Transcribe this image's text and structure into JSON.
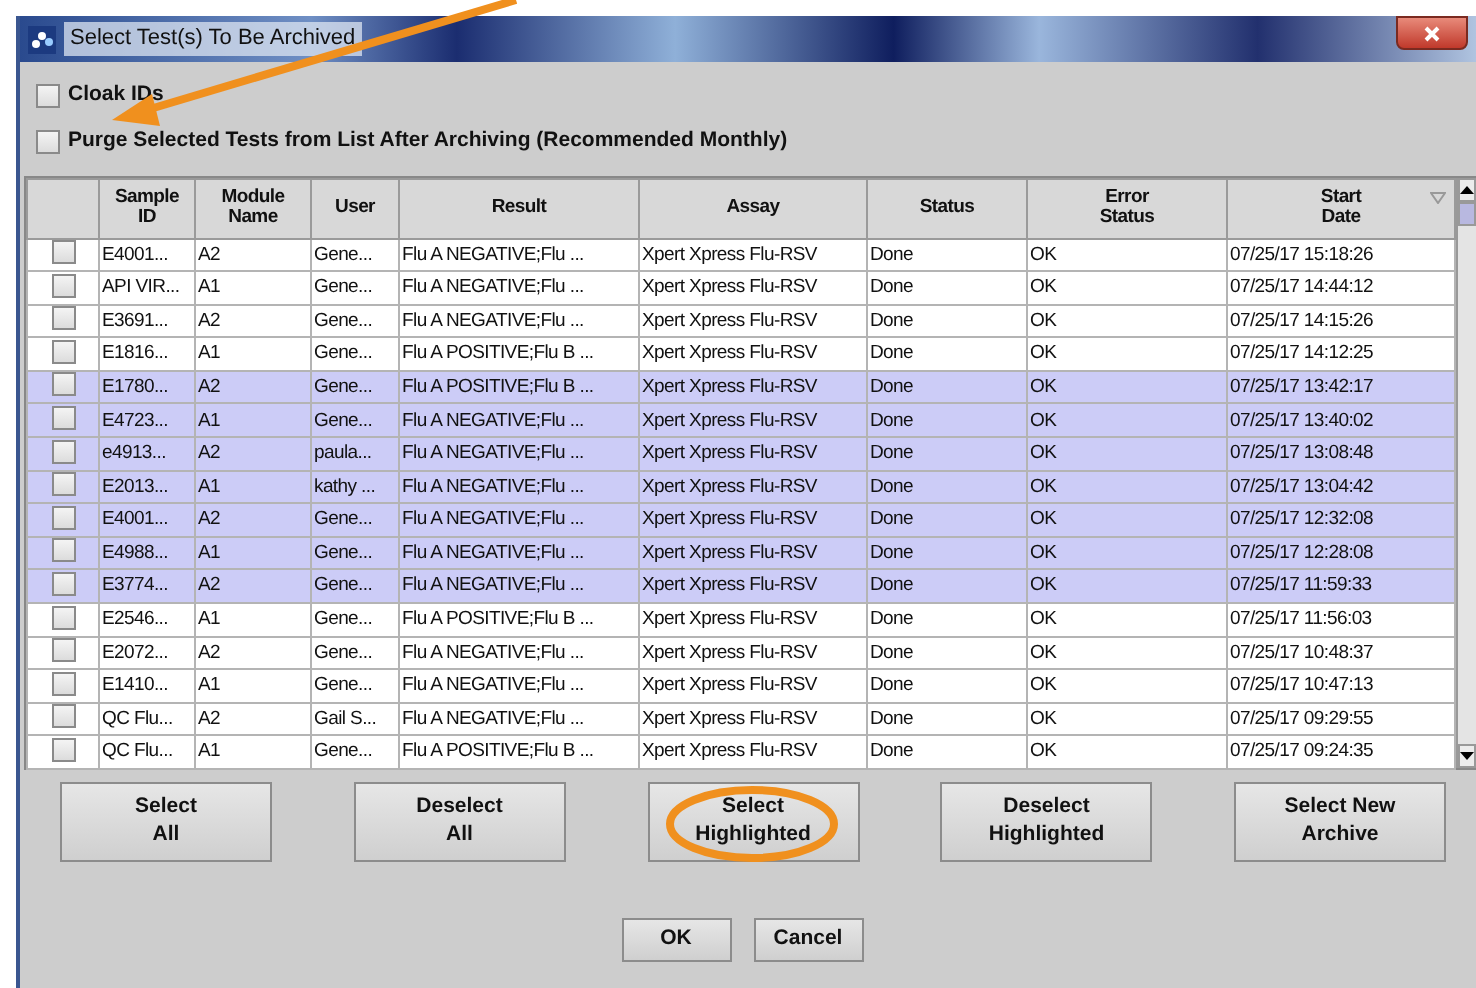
{
  "window": {
    "title": "Select Test(s) To Be Archived"
  },
  "options": [
    {
      "label": "Cloak IDs",
      "checked": false
    },
    {
      "label": "Purge Selected Tests from List After Archiving (Recommended Monthly)",
      "checked": false
    }
  ],
  "table": {
    "columns": [
      {
        "label": "Sample ID",
        "sorted": false
      },
      {
        "label": "Module Name",
        "sorted": false
      },
      {
        "label": "User",
        "sorted": false
      },
      {
        "label": "Result",
        "sorted": false
      },
      {
        "label": "Assay",
        "sorted": false
      },
      {
        "label": "Status",
        "sorted": false
      },
      {
        "label": "Error Status",
        "sorted": false
      },
      {
        "label": "Start Date",
        "sorted": true
      }
    ],
    "rows": [
      {
        "checked": false,
        "selected": false,
        "cells": [
          "E4001...",
          "A2",
          "Gene...",
          "Flu A NEGATIVE;Flu ...",
          "Xpert Xpress Flu-RSV",
          "Done",
          "OK",
          "07/25/17 15:18:26"
        ]
      },
      {
        "checked": false,
        "selected": false,
        "cells": [
          "API VIR...",
          "A1",
          "Gene...",
          "Flu A NEGATIVE;Flu ...",
          "Xpert Xpress Flu-RSV",
          "Done",
          "OK",
          "07/25/17 14:44:12"
        ]
      },
      {
        "checked": false,
        "selected": false,
        "cells": [
          "E3691...",
          "A2",
          "Gene...",
          "Flu A NEGATIVE;Flu ...",
          "Xpert Xpress Flu-RSV",
          "Done",
          "OK",
          "07/25/17 14:15:26"
        ]
      },
      {
        "checked": false,
        "selected": false,
        "cells": [
          "E1816...",
          "A1",
          "Gene...",
          "Flu A POSITIVE;Flu B ...",
          "Xpert Xpress Flu-RSV",
          "Done",
          "OK",
          "07/25/17 14:12:25"
        ]
      },
      {
        "checked": false,
        "selected": true,
        "cells": [
          "E1780...",
          "A2",
          "Gene...",
          "Flu A POSITIVE;Flu B ...",
          "Xpert Xpress Flu-RSV",
          "Done",
          "OK",
          "07/25/17 13:42:17"
        ]
      },
      {
        "checked": false,
        "selected": true,
        "cells": [
          "E4723...",
          "A1",
          "Gene...",
          "Flu A NEGATIVE;Flu ...",
          "Xpert Xpress Flu-RSV",
          "Done",
          "OK",
          "07/25/17 13:40:02"
        ]
      },
      {
        "checked": false,
        "selected": true,
        "cells": [
          "e4913...",
          "A2",
          "paula...",
          "Flu A NEGATIVE;Flu ...",
          "Xpert Xpress Flu-RSV",
          "Done",
          "OK",
          "07/25/17 13:08:48"
        ]
      },
      {
        "checked": false,
        "selected": true,
        "cells": [
          "E2013...",
          "A1",
          "kathy ...",
          "Flu A NEGATIVE;Flu ...",
          "Xpert Xpress Flu-RSV",
          "Done",
          "OK",
          "07/25/17 13:04:42"
        ]
      },
      {
        "checked": false,
        "selected": true,
        "cells": [
          "E4001...",
          "A2",
          "Gene...",
          "Flu A NEGATIVE;Flu ...",
          "Xpert Xpress Flu-RSV",
          "Done",
          "OK",
          "07/25/17 12:32:08"
        ]
      },
      {
        "checked": false,
        "selected": true,
        "cells": [
          "E4988...",
          "A1",
          "Gene...",
          "Flu A NEGATIVE;Flu ...",
          "Xpert Xpress Flu-RSV",
          "Done",
          "OK",
          "07/25/17 12:28:08"
        ]
      },
      {
        "checked": false,
        "selected": true,
        "cells": [
          "E3774...",
          "A2",
          "Gene...",
          "Flu A NEGATIVE;Flu ...",
          "Xpert Xpress Flu-RSV",
          "Done",
          "OK",
          "07/25/17 11:59:33"
        ]
      },
      {
        "checked": false,
        "selected": false,
        "cells": [
          "E2546...",
          "A1",
          "Gene...",
          "Flu A POSITIVE;Flu B ...",
          "Xpert Xpress Flu-RSV",
          "Done",
          "OK",
          "07/25/17 11:56:03"
        ]
      },
      {
        "checked": false,
        "selected": false,
        "cells": [
          "E2072...",
          "A2",
          "Gene...",
          "Flu A NEGATIVE;Flu ...",
          "Xpert Xpress Flu-RSV",
          "Done",
          "OK",
          "07/25/17 10:48:37"
        ]
      },
      {
        "checked": false,
        "selected": false,
        "cells": [
          "E1410...",
          "A1",
          "Gene...",
          "Flu A NEGATIVE;Flu ...",
          "Xpert Xpress Flu-RSV",
          "Done",
          "OK",
          "07/25/17 10:47:13"
        ]
      },
      {
        "checked": false,
        "selected": false,
        "cells": [
          "QC Flu...",
          "A2",
          "Gail S...",
          "Flu A NEGATIVE;Flu ...",
          "Xpert Xpress Flu-RSV",
          "Done",
          "OK",
          "07/25/17 09:29:55"
        ]
      },
      {
        "checked": false,
        "selected": false,
        "cells": [
          "QC Flu...",
          "A1",
          "Gene...",
          "Flu A POSITIVE;Flu B ...",
          "Xpert Xpress Flu-RSV",
          "Done",
          "OK",
          "07/25/17 09:24:35"
        ]
      }
    ]
  },
  "buttons": [
    {
      "label": "Select\nAll"
    },
    {
      "label": "Deselect\nAll"
    },
    {
      "label": "Select\nHighlighted"
    },
    {
      "label": "Deselect\nHighlighted"
    },
    {
      "label": "Select New\nArchive"
    }
  ],
  "dialog_buttons": [
    {
      "label": "OK"
    },
    {
      "label": "Cancel"
    }
  ]
}
